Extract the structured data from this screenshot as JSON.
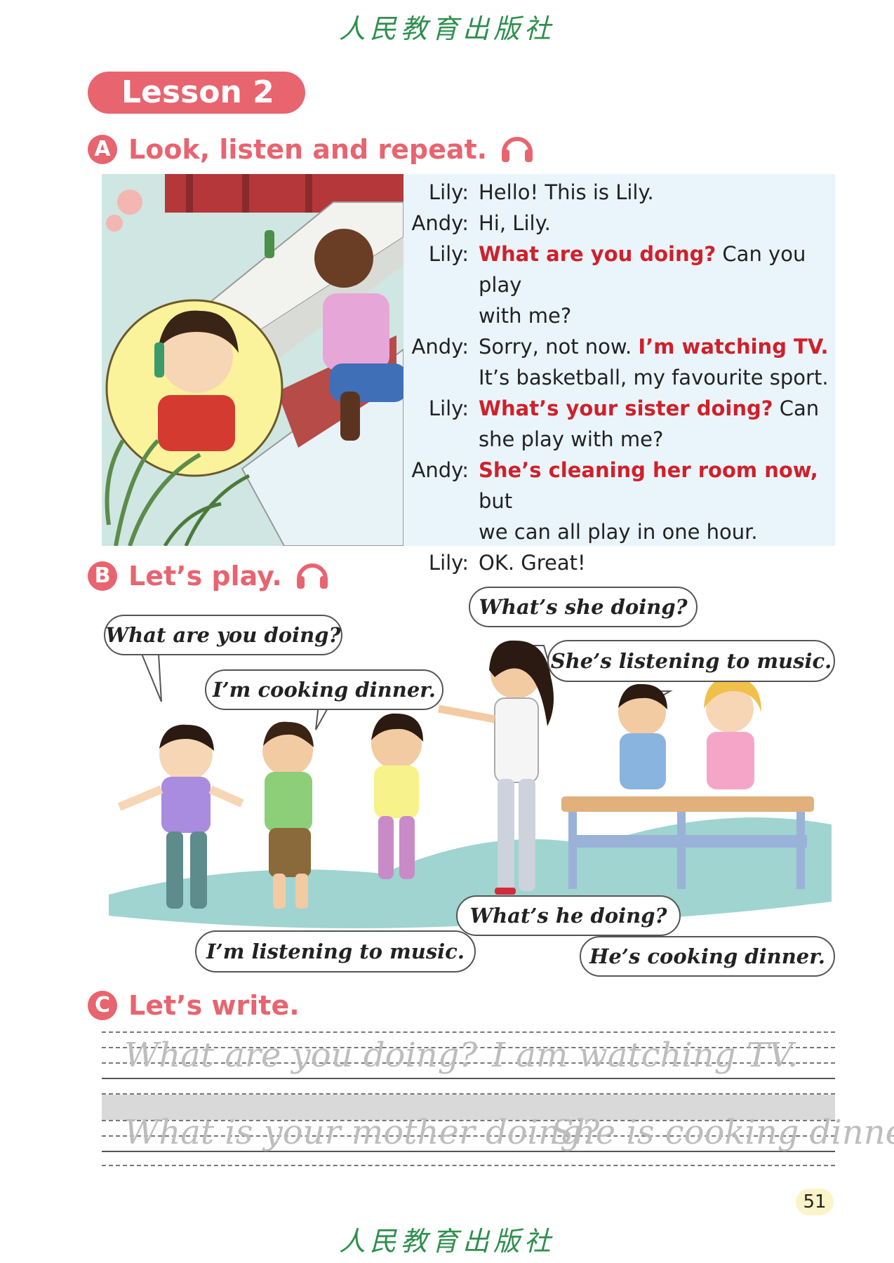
{
  "publisher": "人民教育出版社",
  "lesson": "Lesson 2",
  "sections": {
    "a": {
      "badge": "A",
      "title": "Look, listen and repeat."
    },
    "b": {
      "badge": "B",
      "title": "Let’s play."
    },
    "c": {
      "badge": "C",
      "title": "Let’s write."
    }
  },
  "dialog": [
    {
      "speaker": "Lily:",
      "parts": [
        {
          "t": "Hello! This is Lily.",
          "h": false
        }
      ]
    },
    {
      "speaker": "Andy:",
      "parts": [
        {
          "t": "Hi, Lily.",
          "h": false
        }
      ]
    },
    {
      "speaker": "Lily:",
      "parts": [
        {
          "t": "What are you doing?",
          "h": true
        },
        {
          "t": " Can you play",
          "h": false
        }
      ]
    },
    {
      "speaker": "",
      "parts": [
        {
          "t": "with me?",
          "h": false
        }
      ]
    },
    {
      "speaker": "Andy:",
      "parts": [
        {
          "t": "Sorry, not now. ",
          "h": false
        },
        {
          "t": "I’m watching TV.",
          "h": true
        }
      ]
    },
    {
      "speaker": "",
      "parts": [
        {
          "t": "It’s basketball, my favourite sport.",
          "h": false
        }
      ]
    },
    {
      "speaker": "Lily:",
      "parts": [
        {
          "t": "What’s your sister doing?",
          "h": true
        },
        {
          "t": " Can",
          "h": false
        }
      ]
    },
    {
      "speaker": "",
      "parts": [
        {
          "t": "she play with me?",
          "h": false
        }
      ]
    },
    {
      "speaker": "Andy:",
      "parts": [
        {
          "t": "She’s cleaning her room now,",
          "h": true
        },
        {
          "t": " but",
          "h": false
        }
      ]
    },
    {
      "speaker": "",
      "parts": [
        {
          "t": "we can all play in one hour.",
          "h": false
        }
      ]
    },
    {
      "speaker": "Lily:",
      "parts": [
        {
          "t": "OK. Great!",
          "h": false
        }
      ]
    }
  ],
  "bubbles": {
    "what_are_you_doing": "What are you doing?",
    "im_cooking": "I’m cooking dinner.",
    "whats_she_doing": "What’s she doing?",
    "shes_listening": "She’s listening to music.",
    "im_listening": "I’m listening to music.",
    "whats_he_doing": "What’s he doing?",
    "hes_cooking": "He’s cooking dinner."
  },
  "writing": {
    "line1_q": "What are you doing?",
    "line1_a": "I am watching TV.",
    "line2_q": "What is your mother doing?",
    "line2_a": "She is cooking dinner."
  },
  "page_number": "51",
  "colors": {
    "accent": "#e8646f",
    "highlight": "#d0202a",
    "publisher": "#2f8f4e"
  }
}
